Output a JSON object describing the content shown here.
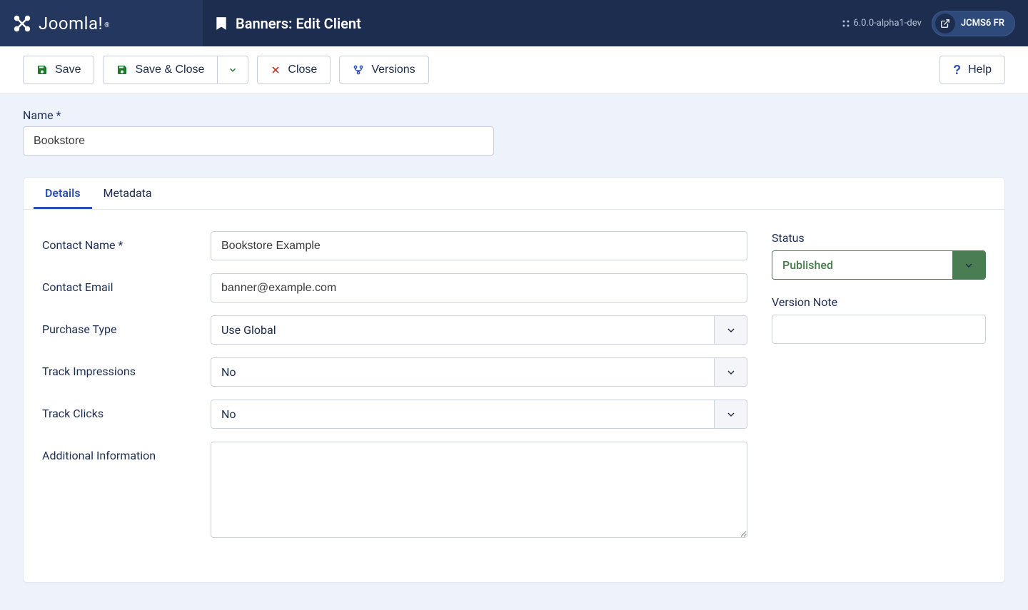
{
  "header": {
    "logo_text": "Joomla!",
    "page_title": "Banners: Edit Client",
    "version": "6.0.0-alpha1-dev",
    "site_name": "JCMS6 FR"
  },
  "toolbar": {
    "save": "Save",
    "save_close": "Save & Close",
    "close": "Close",
    "versions": "Versions",
    "help": "Help"
  },
  "form": {
    "name_label": "Name *",
    "name_value": "Bookstore"
  },
  "tabs": {
    "details": "Details",
    "metadata": "Metadata"
  },
  "details": {
    "contact_name_label": "Contact Name *",
    "contact_name_value": "Bookstore Example",
    "contact_email_label": "Contact Email",
    "contact_email_value": "banner@example.com",
    "purchase_type_label": "Purchase Type",
    "purchase_type_value": "Use Global",
    "track_impr_label": "Track Impressions",
    "track_impr_value": "No",
    "track_clicks_label": "Track Clicks",
    "track_clicks_value": "No",
    "extra_label": "Additional Information",
    "extra_value": ""
  },
  "side": {
    "status_label": "Status",
    "status_value": "Published",
    "version_note_label": "Version Note",
    "version_note_value": ""
  }
}
